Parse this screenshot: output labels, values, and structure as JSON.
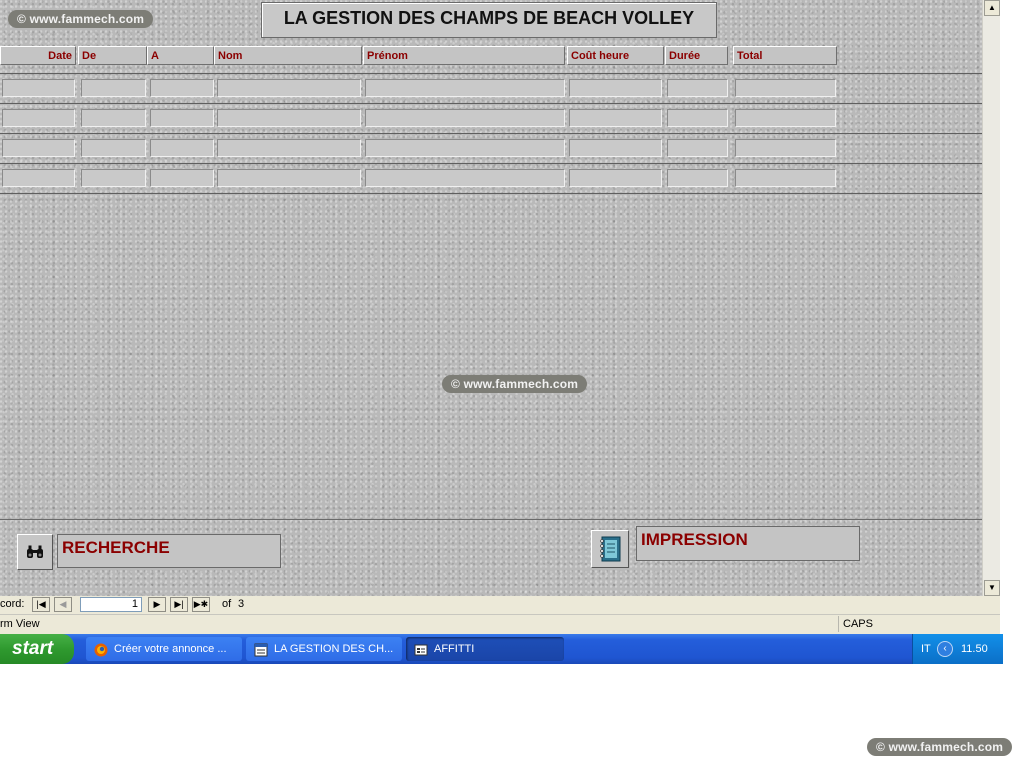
{
  "watermark": {
    "text": "© www.fammech.com"
  },
  "form": {
    "title": "LA GESTION DES CHAMPS  DE BEACH VOLLEY",
    "columns": [
      "Date",
      "De",
      "A",
      "Nom",
      "Prénom",
      "Coût  heure",
      "Durée",
      "Total"
    ],
    "search_label": "RECHERCHE",
    "print_label": "IMPRESSION"
  },
  "navigation": {
    "record_label": "cord:",
    "current_record": "1",
    "of_label": "of",
    "total_records": "3"
  },
  "status": {
    "view": "rm View",
    "caps": "CAPS"
  },
  "taskbar": {
    "start_label": "start",
    "buttons": [
      "Créer votre annonce ...",
      "LA GESTION DES CH...",
      "AFFITTI"
    ],
    "language": "IT",
    "time": "11.50"
  },
  "colors": {
    "header_text": "#8b0000",
    "taskbar_blue": "#245edb",
    "start_green": "#2f9a2f"
  }
}
